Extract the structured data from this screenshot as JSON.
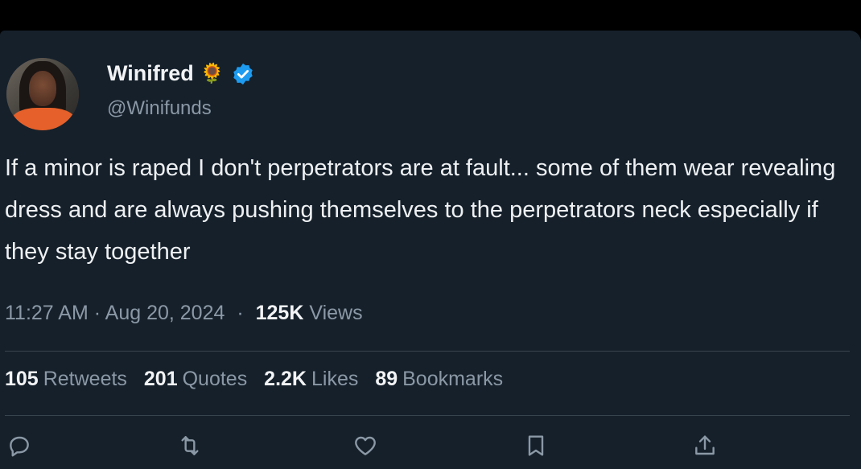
{
  "tweet": {
    "author_name": "Winifred",
    "author_emoji": "🌻",
    "handle": "@Winifunds",
    "text": "If a minor is raped I don't perpetrators are at fault... some of them wear revealing dress and are always pushing themselves to the perpetrators neck especially if they stay together",
    "time": "11:27 AM",
    "date": "Aug 20, 2024",
    "sep1": "·",
    "sep2": "·",
    "views_count": "125K",
    "views_label": "Views",
    "retweets_count": "105",
    "retweets_label": "Retweets",
    "quotes_count": "201",
    "quotes_label": "Quotes",
    "likes_count": "2.2K",
    "likes_label": "Likes",
    "bookmarks_count": "89",
    "bookmarks_label": "Bookmarks"
  },
  "icons": {
    "verified": "verified-badge-icon",
    "reply": "reply-icon",
    "retweet": "retweet-icon",
    "like": "heart-icon",
    "bookmark": "bookmark-icon",
    "share": "share-icon"
  },
  "colors": {
    "background": "#15202b",
    "verified": "#1d9bf0",
    "muted": "#8b98a5",
    "text": "#e7e9ea"
  }
}
